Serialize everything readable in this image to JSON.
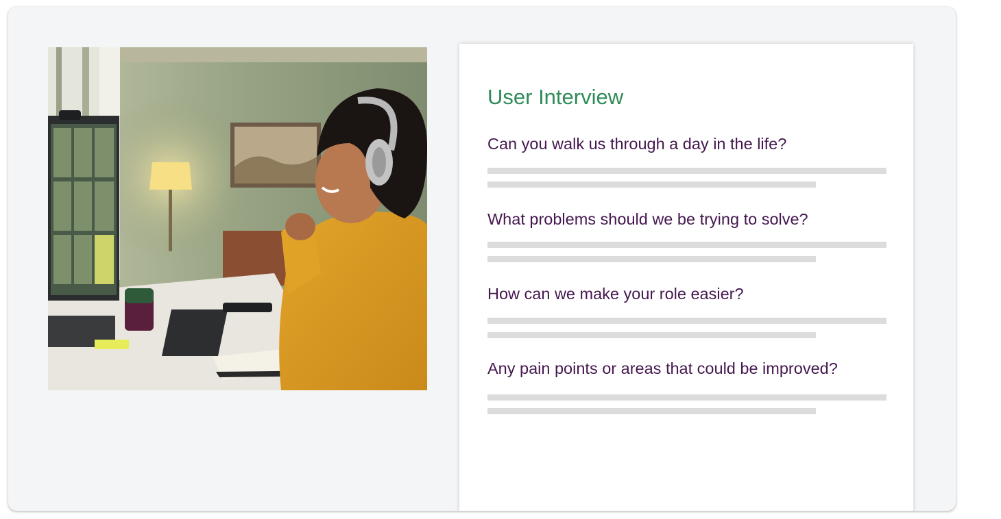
{
  "colors": {
    "title": "#2e8b57",
    "question": "#44174f",
    "placeholder_line": "#dcdcdc",
    "card_background": "#f4f5f7",
    "document_background": "#ffffff"
  },
  "photo": {
    "alt": "Smiling woman with headphones in a yellow sweater on a video call at her desk"
  },
  "document": {
    "title": "User Interview",
    "questions": [
      {
        "text": "Can you walk us through a day in the life?"
      },
      {
        "text": "What problems should we be trying to solve?"
      },
      {
        "text": "How can we make your role easier?"
      },
      {
        "text": "Any pain points or areas that could be improved?"
      }
    ]
  }
}
